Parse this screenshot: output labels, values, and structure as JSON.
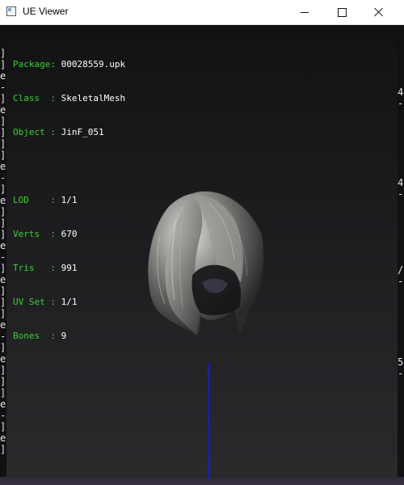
{
  "window": {
    "title": "UE Viewer",
    "icon": "app-window-icon"
  },
  "controls": {
    "minimize": "minimize-icon",
    "maximize": "maximize-icon",
    "close": "close-icon"
  },
  "info": {
    "package": {
      "key": "Package:",
      "value": "00028559.upk"
    },
    "class": {
      "key": "Class  :",
      "value": "SkeletalMesh"
    },
    "object": {
      "key": "Object :",
      "value": "JinF_051"
    },
    "lod": {
      "key": "LOD    :",
      "value": "1/1"
    },
    "verts": {
      "key": "Verts  :",
      "value": "670"
    },
    "tris": {
      "key": "Tris   :",
      "value": "991"
    },
    "uvset": {
      "key": "UV Set :",
      "value": "1/1"
    },
    "bones": {
      "key": "Bones  :",
      "value": "9"
    }
  },
  "colors": {
    "label": "#39d12e",
    "value": "#ffffff",
    "axis": "#1d1db8"
  },
  "background_left_chars": [
    "]",
    "]",
    "e",
    "-",
    "]",
    "e",
    "]",
    "]",
    "]",
    "]",
    "e",
    "-",
    "]",
    "e",
    "]",
    "]",
    "]",
    "e",
    "-",
    "]",
    "e",
    "]",
    "]",
    "]",
    "e",
    "-",
    "]",
    "e",
    "]",
    "]",
    "]",
    "e",
    "-",
    "]",
    "e",
    "]"
  ],
  "background_right_chars": [
    "4",
    "-",
    "4",
    "-",
    "/",
    "-",
    "5",
    "-"
  ]
}
